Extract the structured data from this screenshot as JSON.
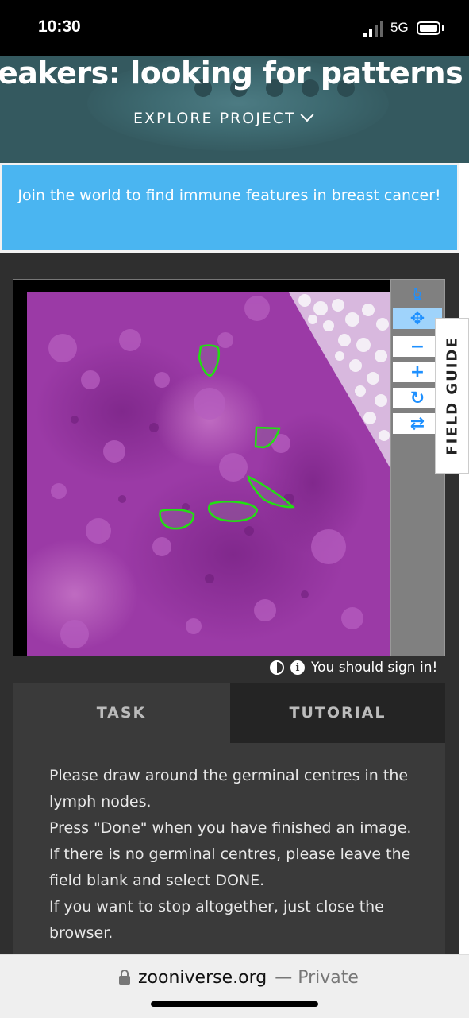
{
  "status_bar": {
    "time": "10:30",
    "network": "5G"
  },
  "project": {
    "title": "eakers: looking for patterns in lym",
    "explore_label": "EXPLORE PROJECT"
  },
  "announcement": "Join the world to find immune features in breast cancer!",
  "viewer": {
    "tools": [
      "pointer-icon",
      "move-icon",
      "zoom-out-icon",
      "zoom-in-icon",
      "rotate-icon",
      "reset-icon"
    ],
    "active_tool": "move-icon",
    "annotation_color": "#22e012",
    "tissue_color": "#9b3aa6"
  },
  "field_guide_label": "FIELD GUIDE",
  "sign_in_text": "You should sign in!",
  "tabs": {
    "task": "TASK",
    "tutorial": "TUTORIAL"
  },
  "instructions": [
    "Please draw around the germinal centres in the lymph nodes.",
    "Press \"Done\" when you have finished an image.",
    "If there is no germinal centres, please leave the field blank and select DONE.",
    "If you want to stop altogether, just close the browser."
  ],
  "browser": {
    "domain": "zooniverse.org",
    "mode": "— Private"
  }
}
